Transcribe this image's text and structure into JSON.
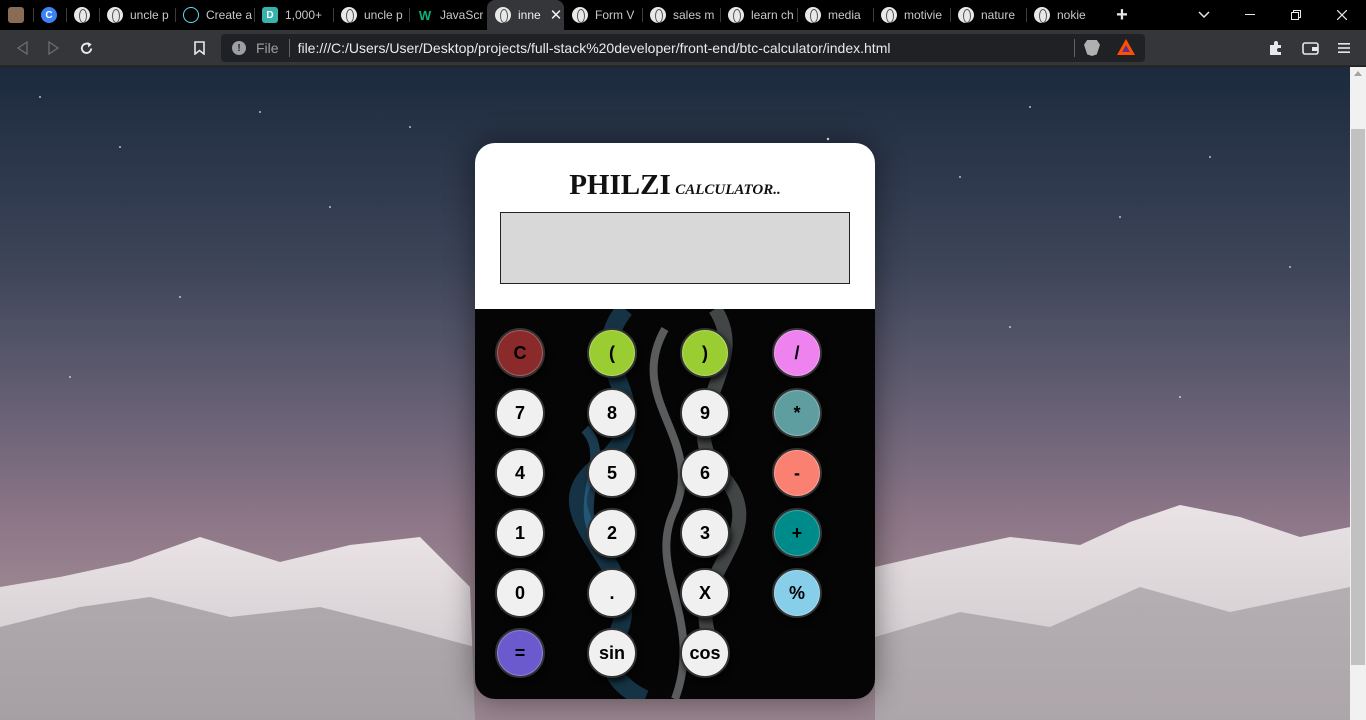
{
  "tabs": [
    {
      "title": "",
      "icon": "profile-photo-icon"
    },
    {
      "title": "",
      "icon": "c-logo-icon"
    },
    {
      "title": "",
      "icon": "globe-icon"
    },
    {
      "title": "uncle p",
      "icon": "globe-icon"
    },
    {
      "title": "Create a",
      "icon": "react-logo-icon"
    },
    {
      "title": "1,000+",
      "icon": "d-logo-icon"
    },
    {
      "title": "uncle p",
      "icon": "globe-icon"
    },
    {
      "title": "JavaScr",
      "icon": "w-logo-icon"
    },
    {
      "title": "inne",
      "icon": "globe-icon",
      "active": true
    },
    {
      "title": "Form V",
      "icon": "globe-icon"
    },
    {
      "title": "sales m",
      "icon": "globe-icon"
    },
    {
      "title": "learn ch",
      "icon": "globe-icon"
    },
    {
      "title": "media",
      "icon": "globe-icon"
    },
    {
      "title": "motivie",
      "icon": "globe-icon"
    },
    {
      "title": "nature",
      "icon": "globe-icon"
    },
    {
      "title": "nokie",
      "icon": "globe-icon"
    }
  ],
  "address": {
    "scheme": "File",
    "url": "file:///C:/Users/User/Desktop/projects/full-stack%20developer/front-end/btc-calculator/index.html"
  },
  "calculator": {
    "title": "PHILZI",
    "subtitle": "CALCULATOR..",
    "display_value": "",
    "keys": [
      {
        "label": "C",
        "color": "#8b2a2a"
      },
      {
        "label": "(",
        "color": "#9acd32"
      },
      {
        "label": ")",
        "color": "#9acd32"
      },
      {
        "label": "/",
        "color": "#ee82ee"
      },
      {
        "label": "7",
        "color": "#f0f0f0"
      },
      {
        "label": "8",
        "color": "#f0f0f0"
      },
      {
        "label": "9",
        "color": "#f0f0f0"
      },
      {
        "label": "*",
        "color": "#5f9ea0"
      },
      {
        "label": "4",
        "color": "#f0f0f0"
      },
      {
        "label": "5",
        "color": "#f0f0f0"
      },
      {
        "label": "6",
        "color": "#f0f0f0"
      },
      {
        "label": "-",
        "color": "#fa8072"
      },
      {
        "label": "1",
        "color": "#f0f0f0"
      },
      {
        "label": "2",
        "color": "#f0f0f0"
      },
      {
        "label": "3",
        "color": "#f0f0f0"
      },
      {
        "label": "+",
        "color": "#008b8b"
      },
      {
        "label": "0",
        "color": "#f0f0f0"
      },
      {
        "label": ".",
        "color": "#f0f0f0"
      },
      {
        "label": "X",
        "color": "#f0f0f0"
      },
      {
        "label": "%",
        "color": "#87ceeb"
      },
      {
        "label": "=",
        "color": "#6a5acd"
      },
      {
        "label": "sin",
        "color": "#f0f0f0"
      },
      {
        "label": "cos",
        "color": "#f0f0f0"
      }
    ]
  }
}
